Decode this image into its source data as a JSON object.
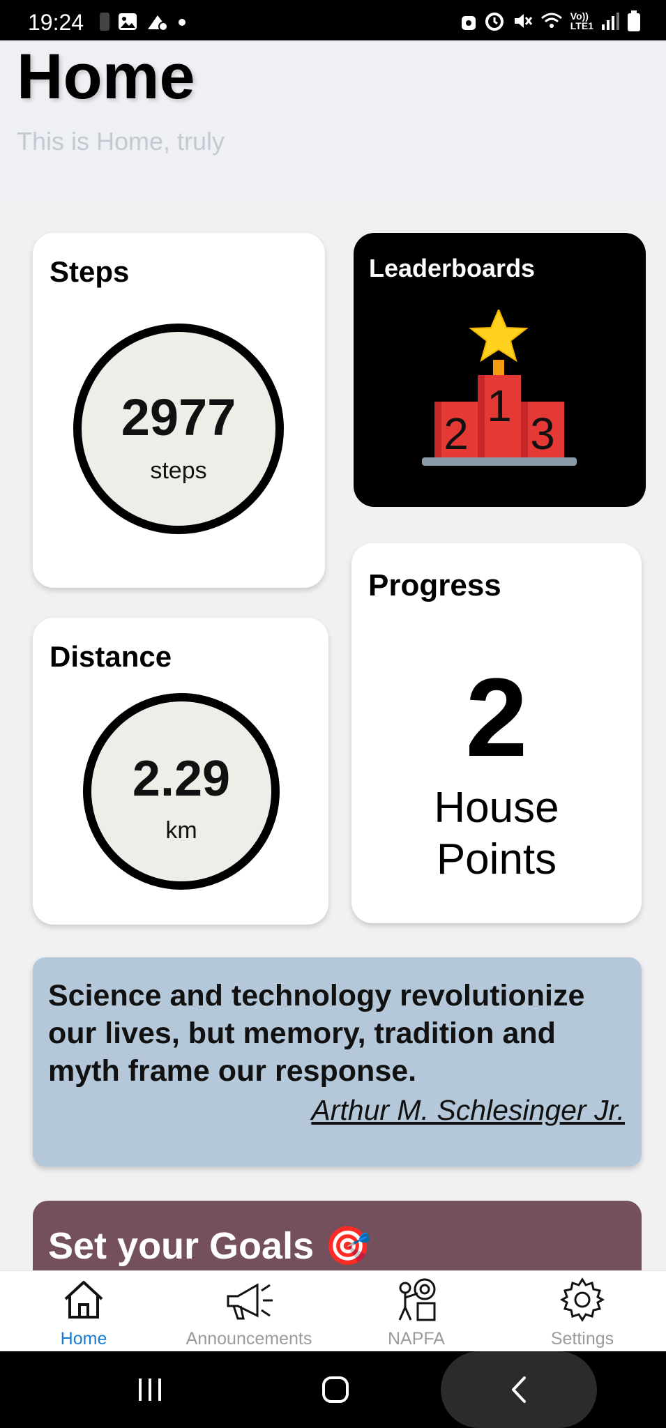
{
  "status_bar": {
    "time": "19:24",
    "network_label": "Vo))\nLTE1",
    "left_icons": [
      "sim-icon",
      "image-icon",
      "notification-icon",
      "dot-icon"
    ],
    "right_icons": [
      "vpn-icon",
      "alarm-icon",
      "mute-icon",
      "wifi-icon",
      "lte-icon",
      "signal-icon",
      "battery-icon"
    ]
  },
  "header": {
    "title": "Home",
    "subtitle": "This is Home, truly"
  },
  "steps_card": {
    "title": "Steps",
    "value": "2977",
    "unit": "steps"
  },
  "leaderboards_card": {
    "title": "Leaderboards",
    "podium": {
      "first": "1",
      "second": "2",
      "third": "3"
    },
    "icon": "podium-trophy-icon"
  },
  "distance_card": {
    "title": "Distance",
    "value": "2.29",
    "unit": "km"
  },
  "progress_card": {
    "title": "Progress",
    "value": "2",
    "label_line1": "House",
    "label_line2": "Points"
  },
  "quote_card": {
    "text": "Science and technology revolutionize our lives, but memory, tradition and myth frame our response.",
    "author": "Arthur M. Schlesinger Jr."
  },
  "goals_card": {
    "title": "Set your Goals 🎯"
  },
  "bottom_nav": {
    "items": [
      {
        "label": "Home",
        "icon": "home-icon",
        "active": true
      },
      {
        "label": "Announcements",
        "icon": "megaphone-icon",
        "active": false
      },
      {
        "label": "NAPFA",
        "icon": "fitness-icon",
        "active": false
      },
      {
        "label": "Settings",
        "icon": "gear-icon",
        "active": false
      }
    ]
  },
  "colors": {
    "active_nav": "#1a7bd4",
    "quote_bg": "#b5c8da",
    "goals_bg": "#744f5c",
    "podium_red": "#e53935"
  }
}
